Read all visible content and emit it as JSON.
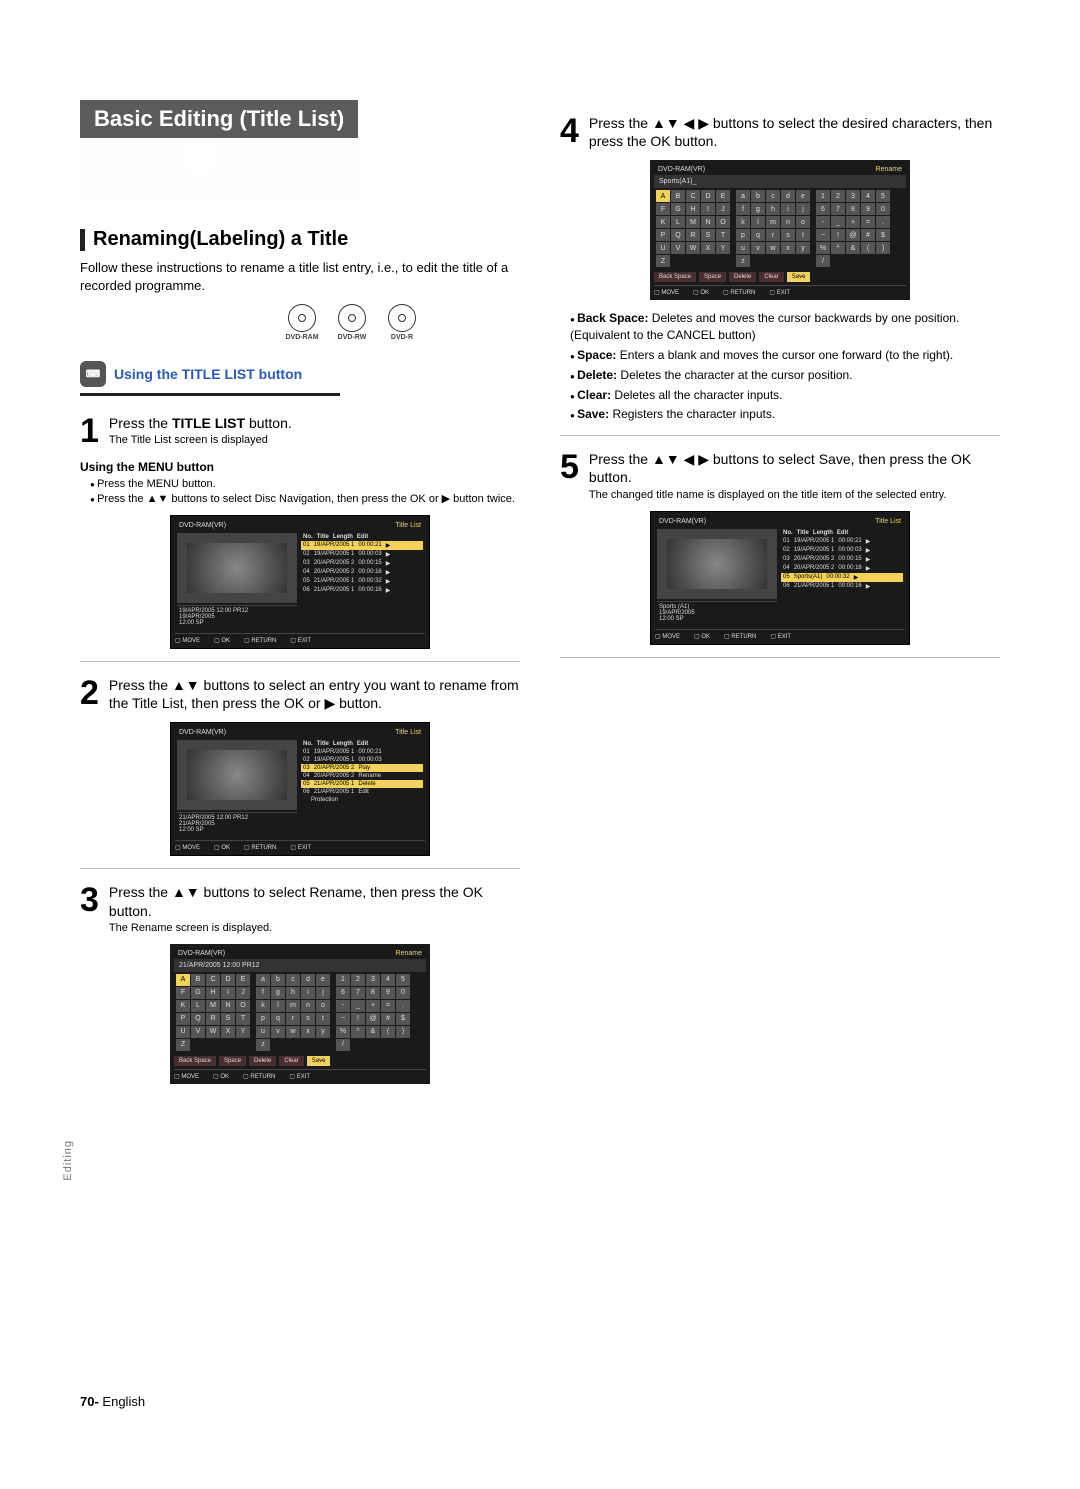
{
  "header": "Basic Editing (Title List)",
  "section": {
    "title": "Renaming(Labeling) a Title",
    "desc": "Follow these instructions to rename a title list entry, i.e., to edit the title of a recorded programme."
  },
  "disc_labels": [
    "DVD-RAM",
    "DVD-RW",
    "DVD-R"
  ],
  "sub_heading": "Using the TITLE LIST button",
  "steps": {
    "s1": {
      "text_pre": "Press the ",
      "text_bold": "TITLE LIST",
      "text_post": " button.",
      "sub": "The Title List screen is displayed"
    },
    "menu_heading": "Using the MENU button",
    "menu_items": [
      "Press the MENU button.",
      "Press the ▲▼ buttons to select Disc Navigation, then press the OK or ▶ button twice."
    ],
    "s2": "Press the ▲▼ buttons to select an entry you want to rename from the Title List, then press the OK or ▶ button.",
    "s3": {
      "text": "Press the ▲▼ buttons to select Rename, then press the OK button.",
      "sub": "The Rename screen is displayed."
    },
    "s4": "Press the ▲▼ ◀ ▶ buttons to select the desired characters, then press the OK button.",
    "s5": {
      "text": "Press the ▲▼ ◀ ▶ buttons to select Save, then press the OK button.",
      "sub": "The changed title name is displayed on the title item of the selected entry."
    }
  },
  "defs": [
    {
      "term": "Back Space:",
      "desc": "Deletes and moves the cursor backwards by one position. (Equivalent to the CANCEL button)"
    },
    {
      "term": "Space:",
      "desc": "Enters a blank and moves the cursor one forward (to the right)."
    },
    {
      "term": "Delete:",
      "desc": "Deletes the character at the cursor position."
    },
    {
      "term": "Clear:",
      "desc": "Deletes all the character inputs."
    },
    {
      "term": "Save:",
      "desc": "Registers the character inputs."
    }
  ],
  "osd": {
    "device": "DVD-RAM(VR)",
    "title_list": "Title List",
    "rename": "Rename",
    "list_hdr": [
      "No.",
      "Title",
      "Length",
      "Edit"
    ],
    "rows1": [
      [
        "01",
        "19/APR/2005 1",
        "00:00:21",
        "▶"
      ],
      [
        "02",
        "19/APR/2005 1",
        "00:00:03",
        "▶"
      ],
      [
        "03",
        "20/APR/2005 2",
        "00:00:15",
        "▶"
      ],
      [
        "04",
        "20/APR/2005 2",
        "00:00:16",
        "▶"
      ],
      [
        "05",
        "21/APR/2005 1",
        "00:00:32",
        "▶"
      ],
      [
        "06",
        "21/APR/2005 1",
        "00:00:16",
        "▶"
      ]
    ],
    "rows2_context": [
      [
        "01",
        "19/APR/2005 1",
        "00:00:21",
        "▶"
      ],
      [
        "02",
        "19/APR/2005 1",
        "00:00:03",
        "▶"
      ],
      [
        "03",
        "20/APR/2005 2",
        "Play",
        ""
      ],
      [
        "04",
        "20/APR/2005 2",
        "Rename",
        ""
      ],
      [
        "05",
        "21/APR/2005 1",
        "Delete",
        ""
      ],
      [
        "06",
        "21/APR/2005 1",
        "Edit",
        ""
      ],
      [
        "",
        "",
        "Protection",
        ""
      ]
    ],
    "rows5": [
      [
        "01",
        "19/APR/2005 1",
        "00:00:21",
        "▶"
      ],
      [
        "02",
        "19/APR/2005 1",
        "00:00:03",
        "▶"
      ],
      [
        "03",
        "20/APR/2005 2",
        "00:00:15",
        "▶"
      ],
      [
        "04",
        "20/APR/2005 2",
        "00:00:16",
        "▶"
      ],
      [
        "05",
        "Sports(A1)",
        "00:00:32",
        "▶"
      ],
      [
        "06",
        "21/APR/2005 1",
        "00:00:16",
        "▶"
      ]
    ],
    "info1": "19/APR/2005 12:00 PR12\n19/APR/2005\n12:00          SP",
    "info2": "21/APR/2005 12:00 PR12\n21/APR/2005\n12:00          SP",
    "info5": "Sports (A1)\n19/APR/2005\n12:00          SP",
    "foot": [
      "MOVE",
      "OK",
      "RETURN",
      "EXIT"
    ],
    "rename_entry1": "21/APR/2005 12:00 PR12",
    "rename_entry2": "Sports(A1)_",
    "kb_upper": [
      "A",
      "B",
      "C",
      "D",
      "E",
      "F",
      "G",
      "H",
      "I",
      "J",
      "K",
      "L",
      "M",
      "N",
      "O",
      "P",
      "Q",
      "R",
      "S",
      "T",
      "U",
      "V",
      "W",
      "X",
      "Y",
      "Z"
    ],
    "kb_lower": [
      "a",
      "b",
      "c",
      "d",
      "e",
      "f",
      "g",
      "h",
      "i",
      "j",
      "k",
      "l",
      "m",
      "n",
      "o",
      "p",
      "q",
      "r",
      "s",
      "t",
      "u",
      "v",
      "w",
      "x",
      "y",
      "z"
    ],
    "kb_sym": [
      "1",
      "2",
      "3",
      "4",
      "5",
      "6",
      "7",
      "8",
      "9",
      "0",
      "-",
      "_",
      "+",
      "=",
      ".",
      "~",
      "!",
      "@",
      "#",
      "$",
      "%",
      "^",
      "&",
      "(",
      ")",
      "/"
    ],
    "kb_actions": [
      "Back Space",
      "Space",
      "Delete",
      "Clear",
      "Save"
    ]
  },
  "side_tab": "Editing",
  "footer": {
    "page": "70-",
    "lang": "English"
  }
}
